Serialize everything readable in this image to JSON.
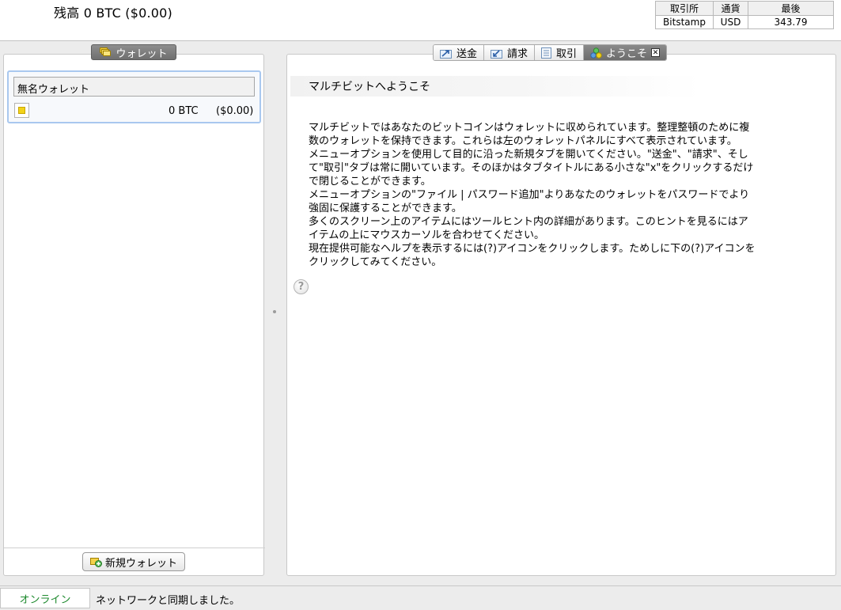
{
  "header": {
    "balance_label": "残高",
    "balance_btc": "0 BTC",
    "balance_fiat": "($0.00)"
  },
  "rate_table": {
    "headers": [
      "取引所",
      "通貨",
      "最後"
    ],
    "row": {
      "exchange": "Bitstamp",
      "currency": "USD",
      "last": "343.79"
    }
  },
  "left_panel": {
    "tab_label": "ウォレット",
    "wallet": {
      "name": "無名ウォレット",
      "btc": "0 BTC",
      "fiat": "($0.00)"
    },
    "new_wallet_label": "新規ウォレット"
  },
  "tabs": [
    {
      "label": "送金",
      "icon": "send-icon"
    },
    {
      "label": "請求",
      "icon": "request-icon"
    },
    {
      "label": "取引",
      "icon": "transactions-icon"
    },
    {
      "label": "ようこそ",
      "icon": "welcome-icon",
      "active": true
    }
  ],
  "welcome": {
    "title": "マルチビットへようこそ",
    "lines": [
      "マルチビットではあなたのビットコインはウォレットに収められています。整理整頓のために複",
      "数のウォレットを保持できます。これらは左のウォレットパネルにすべて表示されています。",
      "メニューオプションを使用して目的に沿った新規タブを開いてください。\"送金\"、\"請求\"、そし",
      "て\"取引\"タブは常に開いています。そのほかはタブタイトルにある小さな\"x\"をクリックするだけ",
      "で閉じることができます。",
      "メニューオプションの\"ファイル | パスワード追加\"よりあなたのウォレットをパスワードでより",
      "強固に保護することができます。",
      "多くのスクリーン上のアイテムにはツールヒント内の詳細があります。このヒントを見るにはア",
      "イテムの上にマウスカーソルを合わせてください。",
      "現在提供可能なヘルプを表示するには(?)アイコンをクリックします。ためしに下の(?)アイコンを",
      "クリックしてみてください。"
    ],
    "help_symbol": "?"
  },
  "statusbar": {
    "online": "オンライン",
    "message": "ネットワークと同期しました。"
  },
  "colors": {
    "online_green": "#1e8a2e",
    "selection_border": "#a9c8ef",
    "active_tab": "#7c7c7c",
    "wallet_dot": "#f2d21a"
  }
}
